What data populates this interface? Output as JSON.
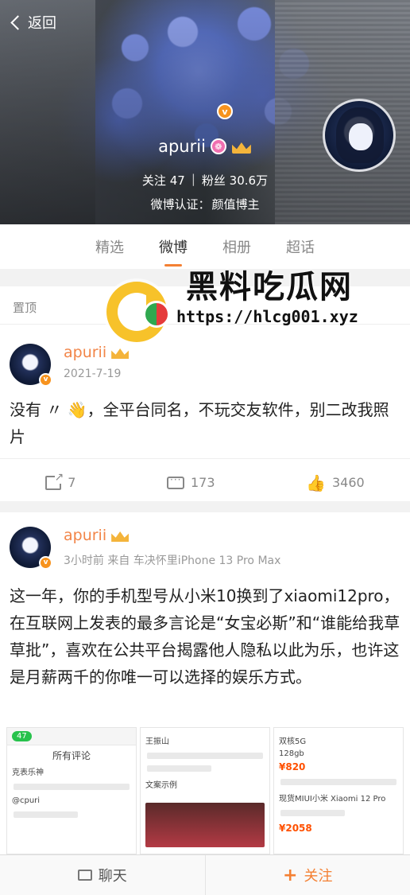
{
  "nav": {
    "back_label": "返回"
  },
  "profile": {
    "username": "apurii",
    "following_label": "关注",
    "following_count": "47",
    "followers_label": "粉丝",
    "followers_count": "30.6万",
    "verify_label": "微博认证：",
    "verify_value": "颜值博主"
  },
  "tabs": [
    {
      "label": "精选",
      "active": false
    },
    {
      "label": "微博",
      "active": true
    },
    {
      "label": "相册",
      "active": false
    },
    {
      "label": "超话",
      "active": false
    }
  ],
  "pinned_label": "置顶",
  "watermark": {
    "title": "黑料吃瓜网",
    "url": "https://hlcg001.xyz"
  },
  "posts": [
    {
      "author": "apurii",
      "meta": "2021-7-19",
      "text": "没有 〃 👋，全平台同名，不玩交友软件，别二改我照片",
      "shares": "7",
      "comments": "173",
      "likes": "3460"
    },
    {
      "author": "apurii",
      "meta": "3小时前 来自 车决怀里iPhone 13 Pro Max",
      "text": "这一年，你的手机型号从小米10换到了xiaomi12pro，在互联网上发表的最多言论是“女宝必斯”和“谁能给我草草批”，喜欢在公共平台揭露他人隐私以此为乐，也许这是月薪两千的你唯一可以选择的娱乐方式。",
      "thumbs": {
        "t1": {
          "time": "47",
          "title": "所有评论",
          "line1": "克表乐神",
          "line2": "@cpuri"
        },
        "t2": {
          "name": "王振山",
          "line1": "文案示例"
        },
        "t3": {
          "tag": "双核5G",
          "spec": "128gb",
          "price": "¥820",
          "title": "现货MIUI小米 Xiaomi 12 Pro",
          "price2": "¥2058"
        }
      }
    }
  ],
  "bottom": {
    "chat_label": "聊天",
    "follow_label": "关注"
  },
  "colors": {
    "accent": "#f48033",
    "name": "#f28548",
    "verify_badge": "#f7931e"
  }
}
